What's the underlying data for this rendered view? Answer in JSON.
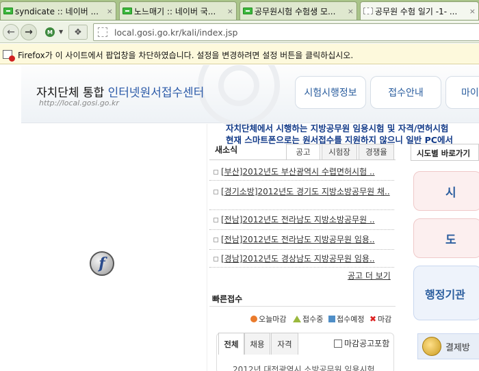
{
  "browser": {
    "tabs": [
      {
        "title": "syndicate :: 네이버 ...",
        "close": "×"
      },
      {
        "title": "노느매기 :: 네이버 국...",
        "close": "×"
      },
      {
        "title": "공무원시험 수험생 모...",
        "close": "×"
      },
      {
        "title": "공무원 수험 일기 -1- ...",
        "close": "×"
      }
    ],
    "back_icon": "back-arrow-icon",
    "forward_icon": "forward-arrow-icon",
    "url": "local.gosi.go.kr/kali/index.jsp",
    "popup_message": "Firefox가 이 사이트에서 팝업창을 차단하였습니다. 설정을 변경하려면 설정 버튼을 클릭하십시오."
  },
  "site": {
    "brand_main": "자치단체 통합 ",
    "brand_sub": "인터넷원서접수센터",
    "brand_url": "http://local.gosi.go.kr",
    "nav": [
      "시험시행정보",
      "접수안내",
      "마이"
    ],
    "notice_line1": "자치단체에서 시행하는 지방공무원 임용시험 및 자격/면허시험",
    "notice_line2": "현재 스마트폰으로는 원서접수를 지원하지 않으니 일반 PC에서"
  },
  "news": {
    "title": "새소식",
    "tabs": [
      "공고",
      "시험장",
      "경쟁율"
    ],
    "items": [
      "[부산]2012년도 부산광역시 수렵면허시험 ..",
      "[경기소방]2012년도 경기도 지방소방공무원 채..",
      "[전남]2012년도 전라남도 지방소방공무원 ..",
      "[전남]2012년도 전라남도 지방공무원 임용..",
      "[경남]2012년도 경상남도 지방공무원 임용.."
    ],
    "more": "공고 더 보기"
  },
  "quick": {
    "title": "빠른접수",
    "legend": [
      "오늘마감",
      "접수중",
      "접수예정",
      "마감"
    ],
    "closed_mark": "✖",
    "tabs": [
      "전체",
      "채용",
      "자격"
    ],
    "include_closed": "마감공고포함",
    "partial_row": "2012년 대전광역시 소방공무원 임용시험"
  },
  "region": {
    "title": "시도별 바로가기",
    "buttons": [
      "시",
      "도"
    ],
    "agency": "행정기관",
    "pay": "결제방"
  },
  "colors": {
    "tab_strip": "#a9c489",
    "popup_bar": "#fdf9dc",
    "brand_blue": "#2a5d9e"
  }
}
